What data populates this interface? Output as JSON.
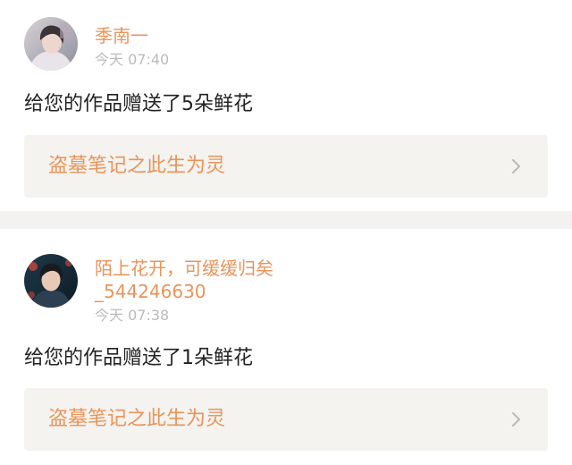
{
  "notifications": [
    {
      "user_name": "季南一",
      "user_name_line2": "",
      "time": "今天 07:40",
      "message": "给您的作品赠送了5朵鲜花",
      "work_title": "盗墓笔记之此生为灵"
    },
    {
      "user_name": "陌上花开，可缓缓归矣",
      "user_name_line2": "_544246630",
      "time": "今天 07:38",
      "message": "给您的作品赠送了1朵鲜花",
      "work_title": "盗墓笔记之此生为灵"
    }
  ],
  "colors": {
    "accent": "#e9945a",
    "timestamp": "#bbbbbb",
    "message_text": "#222222",
    "link_card_bg": "#f4f3ef",
    "separator": "#f3f2f0"
  },
  "icons": {
    "link_arrow": "chevron-right-icon"
  }
}
